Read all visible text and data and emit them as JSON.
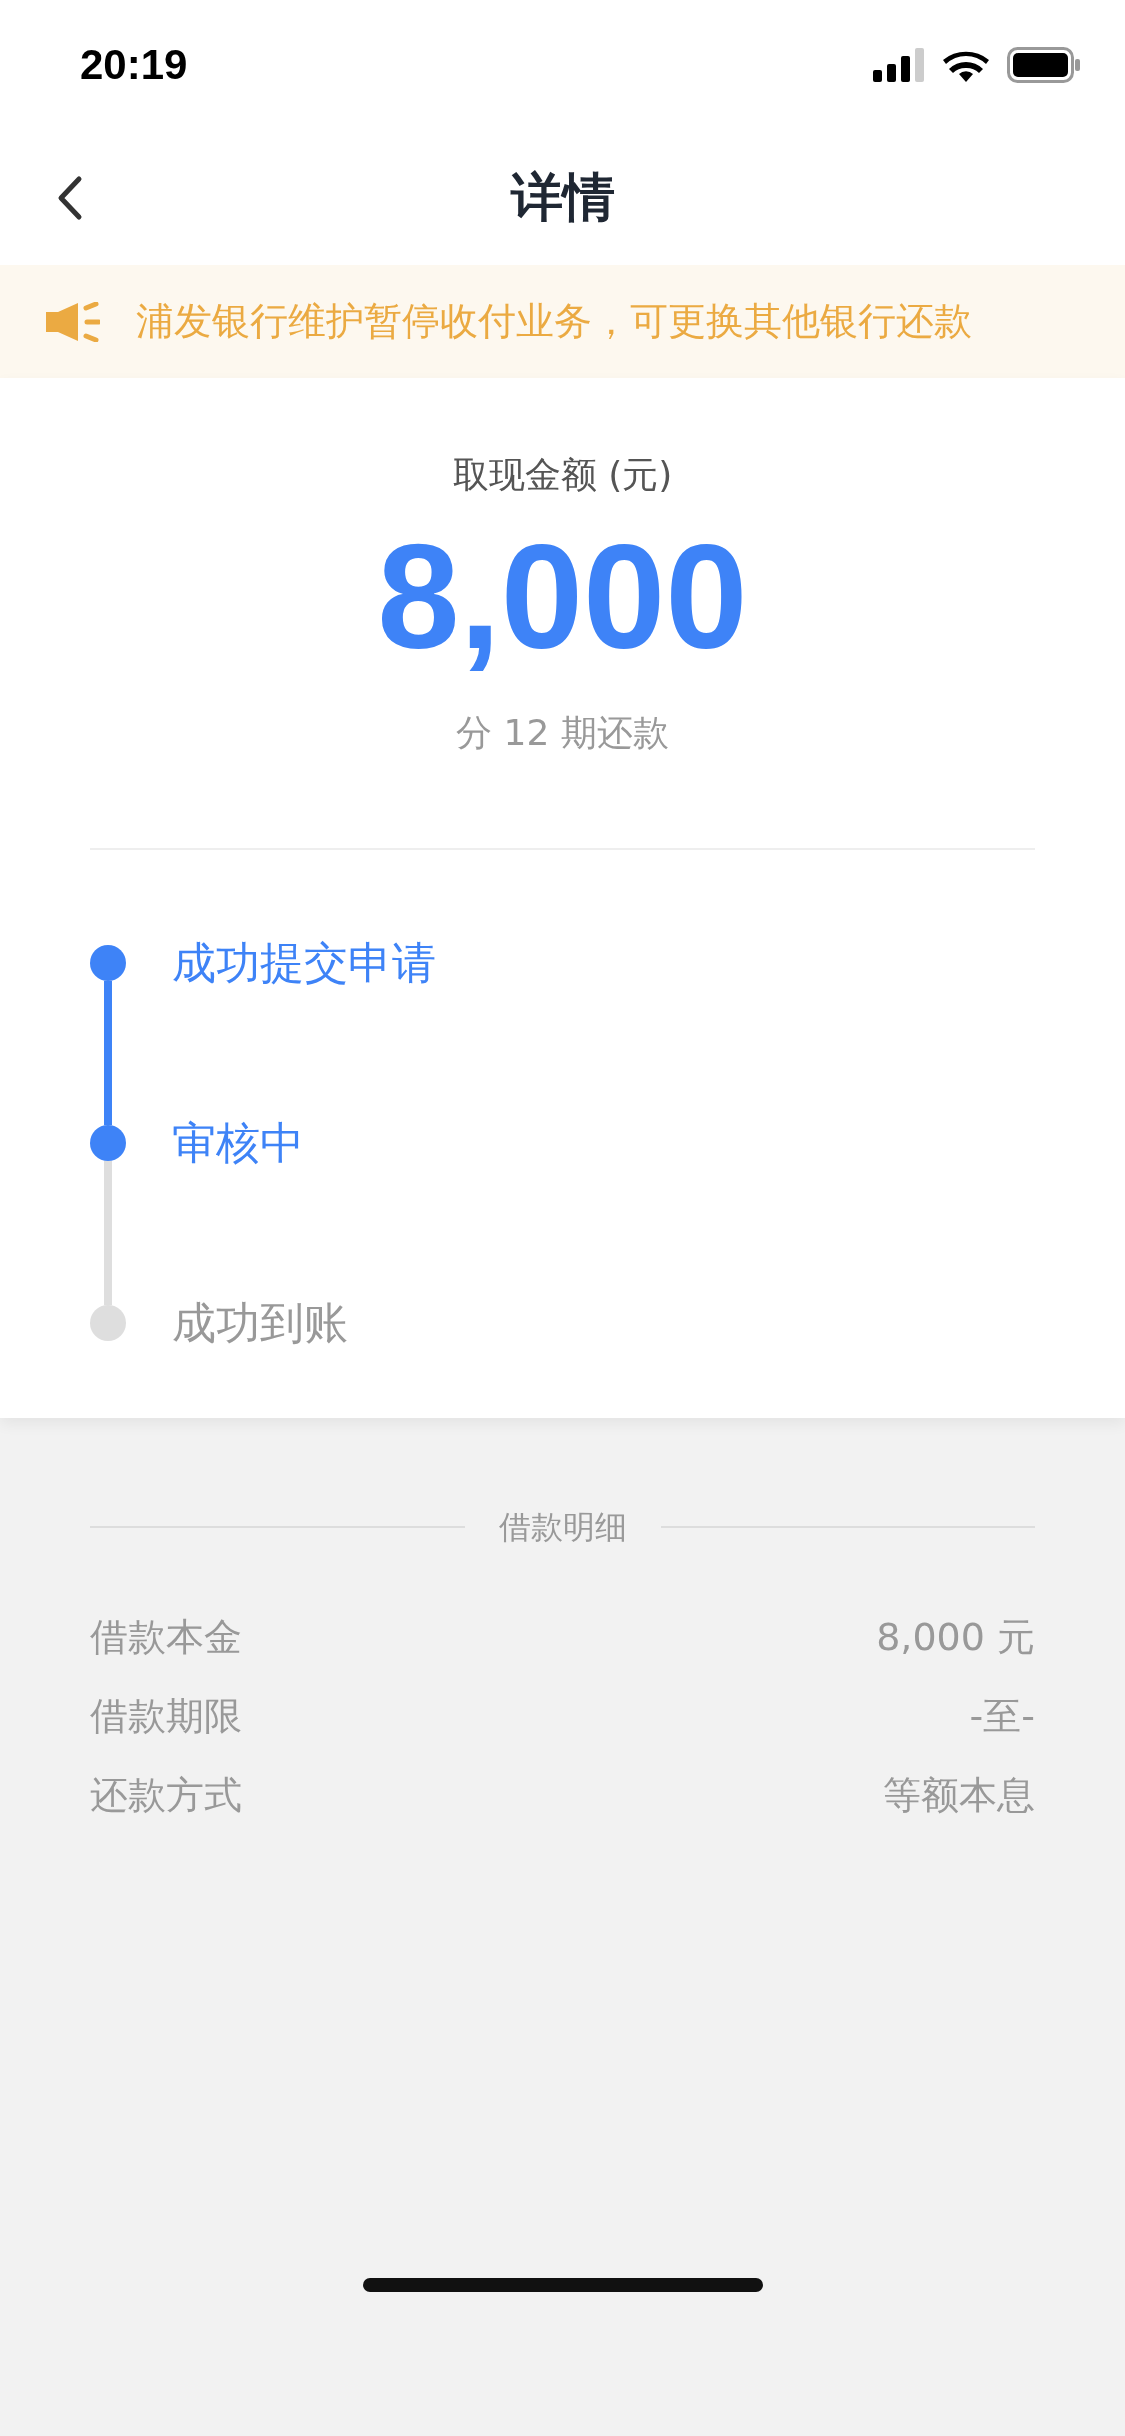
{
  "status_bar": {
    "time": "20:19"
  },
  "nav": {
    "title": "详情"
  },
  "notice": {
    "text": "浦发银行维护暂停收付业务，可更换其他银行还款"
  },
  "amount": {
    "label": "取现金额 (元)",
    "value": "8,000",
    "installments": "分 12 期还款"
  },
  "steps": [
    {
      "label": "成功提交申请",
      "active": true
    },
    {
      "label": "审核中",
      "active": true
    },
    {
      "label": "成功到账",
      "active": false
    }
  ],
  "details": {
    "title": "借款明细",
    "rows": [
      {
        "label": "借款本金",
        "value": "8,000 元"
      },
      {
        "label": "借款期限",
        "value": "-至-"
      },
      {
        "label": "还款方式",
        "value": "等额本息"
      }
    ]
  }
}
